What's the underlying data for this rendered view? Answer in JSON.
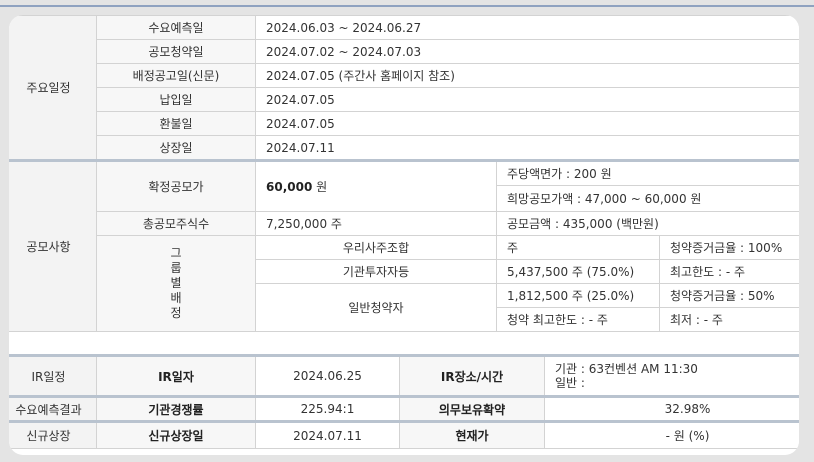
{
  "schedule": {
    "title": "주요일정",
    "rows": [
      {
        "label": "수요예측일",
        "value": "2024.06.03  ~  2024.06.27"
      },
      {
        "label": "공모청약일",
        "value": "2024.07.02  ~  2024.07.03"
      },
      {
        "label": "배정공고일(신문)",
        "value": "2024.07.05 (주간사 홈페이지 참조)"
      },
      {
        "label": "납입일",
        "value": "2024.07.05"
      },
      {
        "label": "환불일",
        "value": "2024.07.05"
      },
      {
        "label": "상장일",
        "value": "2024.07.11"
      }
    ]
  },
  "offering": {
    "title": "공모사항",
    "final_price_label": "확정공모가",
    "final_price_value": "60,000",
    "final_price_unit": " 원",
    "par_value": "주당액면가 :  200 원",
    "hope_price": "희망공모가액 :  47,000 ~ 60,000 원",
    "total_shares_label": "총공모주식수",
    "total_shares_value": "7,250,000 주",
    "amount": "공모금액 : 435,000 (백만원)",
    "alloc_label": [
      "그",
      "룹",
      "별",
      "배",
      "정"
    ],
    "employee_label": "우리사주조합",
    "employee_shares": "주",
    "employee_margin": "청약증거금율 : 100%",
    "inst_label": "기관투자자등",
    "inst_shares": "5,437,500 주  (75.0%)",
    "inst_limit": "최고한도 :  - 주",
    "retail_label": "일반청약자",
    "retail_shares": "1,812,500 주  (25.0%)",
    "retail_margin": "청약증거금율 : 50%",
    "retail_max": "청약 최고한도 :  - 주",
    "retail_min": "최저 :  - 주"
  },
  "ir": {
    "title": "IR일정",
    "date_label": "IR일자",
    "date_value": "2024.06.25",
    "place_label": "IR장소/시간",
    "place_inst": "기관 : 63컨벤션 AM 11:30",
    "place_retail": "일반 :"
  },
  "demand": {
    "title": "수요예측결과",
    "competition_label": "기관경쟁률",
    "competition_value": "225.94:1",
    "lockup_label": "의무보유확약",
    "lockup_value": "32.98%"
  },
  "listing": {
    "title": "신규상장",
    "date_label": "신규상장일",
    "date_value": "2024.07.11",
    "price_label": "현재가",
    "price_value": "- 원 (%)"
  }
}
